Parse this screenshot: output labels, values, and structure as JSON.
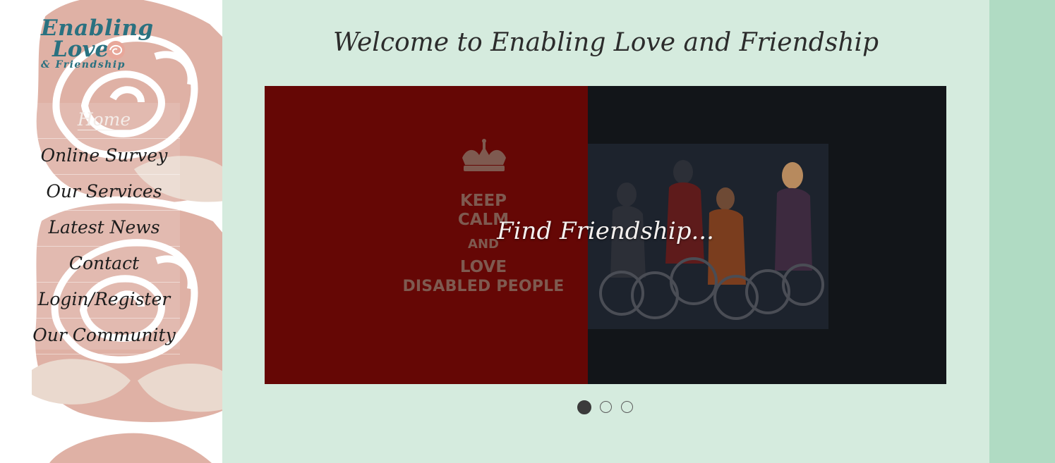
{
  "logo": {
    "line1": "Enabling",
    "line2": "Love",
    "line3": "& Friendship"
  },
  "nav": {
    "items": [
      {
        "label": "Home",
        "active": true
      },
      {
        "label": "Online Survey",
        "active": false
      },
      {
        "label": "Our Services",
        "active": false
      },
      {
        "label": "Latest News",
        "active": false
      },
      {
        "label": "Contact",
        "active": false
      },
      {
        "label": "Login/Register",
        "active": false
      },
      {
        "label": "Our Community",
        "active": false
      }
    ]
  },
  "main": {
    "welcome_title": "Welcome to Enabling Love and Friendship"
  },
  "slider": {
    "caption": "Find Friendship...",
    "slide_image_text": {
      "keep": "KEEP",
      "calm": "CALM",
      "and": "AND",
      "love": "LOVE",
      "disabled": "DISABLED PEOPLE"
    },
    "dots_total": 3,
    "active_dot": 1
  },
  "colors": {
    "sidebar_rose": "#dfb1a5",
    "main_bg": "#d5ebde",
    "right_strip": "#b0dbc3",
    "logo_teal": "#2a7180",
    "slide_red": "#650705",
    "slide_dark": "#121519"
  },
  "icons": {
    "crown": "crown-icon",
    "logo_rose": "rose-icon"
  }
}
